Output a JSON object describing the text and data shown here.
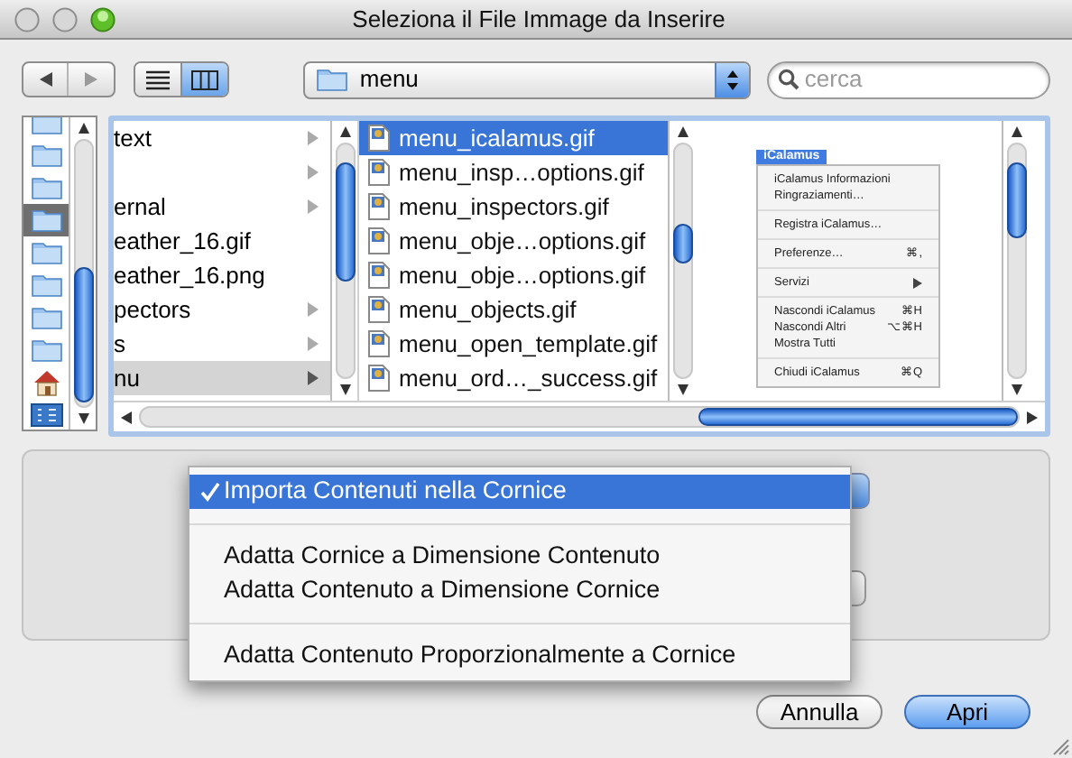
{
  "window": {
    "title": "Seleziona il File Immage da Inserire"
  },
  "toolbar": {
    "view_modes": [
      {
        "kind": "list",
        "selected": false
      },
      {
        "kind": "columns",
        "selected": true
      }
    ],
    "location": {
      "label": "menu"
    },
    "search": {
      "placeholder": "cerca"
    }
  },
  "sidebar": {
    "items": [
      {
        "kind": "folder",
        "selected": false
      },
      {
        "kind": "folder",
        "selected": false
      },
      {
        "kind": "folder",
        "selected": false
      },
      {
        "kind": "folder",
        "selected": true
      },
      {
        "kind": "folder",
        "selected": false
      },
      {
        "kind": "folder",
        "selected": false
      },
      {
        "kind": "folder",
        "selected": false
      },
      {
        "kind": "folder",
        "selected": false
      },
      {
        "kind": "home",
        "selected": false
      },
      {
        "kind": "applications",
        "selected": false
      }
    ]
  },
  "browser": {
    "parent_column": [
      {
        "label": "text",
        "folder": true,
        "selected": false
      },
      {
        "folder": true,
        "selected": false
      },
      {
        "label": "ernal",
        "folder": true,
        "selected": false
      },
      {
        "label": "eather_16.gif",
        "folder": false,
        "selected": false
      },
      {
        "label": "eather_16.png",
        "folder": false,
        "selected": false
      },
      {
        "label": "pectors",
        "folder": true,
        "selected": false
      },
      {
        "label": "s",
        "folder": true,
        "selected": false
      },
      {
        "label": "nu",
        "folder": true,
        "selected": true
      }
    ],
    "file_column": [
      {
        "label": "menu_icalamus.gif",
        "selected": true
      },
      {
        "label": "menu_insp…options.gif",
        "selected": false
      },
      {
        "label": "menu_inspectors.gif",
        "selected": false
      },
      {
        "label": "menu_obje…options.gif",
        "selected": false
      },
      {
        "label": "menu_obje…options.gif",
        "selected": false
      },
      {
        "label": "menu_objects.gif",
        "selected": false
      },
      {
        "label": "menu_open_template.gif",
        "selected": false
      },
      {
        "label": "menu_ord…_success.gif",
        "selected": false
      }
    ],
    "preview": {
      "menu_title": "iCalamus",
      "groups": [
        [
          {
            "label": "iCalamus Informazioni"
          },
          {
            "label": "Ringraziamenti…"
          }
        ],
        [
          {
            "label": "Registra iCalamus…"
          }
        ],
        [
          {
            "label": "Preferenze…",
            "shortcut": "⌘,"
          }
        ],
        [
          {
            "label": "Servizi",
            "submenu": true
          }
        ],
        [
          {
            "label": "Nascondi iCalamus",
            "shortcut": "⌘H"
          },
          {
            "label": "Nascondi Altri",
            "shortcut": "⌥⌘H"
          },
          {
            "label": "Mostra Tutti"
          }
        ],
        [
          {
            "label": "Chiudi iCalamus",
            "shortcut": "⌘Q"
          }
        ]
      ]
    }
  },
  "options_menu": {
    "items": [
      {
        "kind": "item",
        "label": "Importa Contenuti nella Cornice",
        "checked": true,
        "selected": true
      },
      {
        "kind": "separator"
      },
      {
        "kind": "item",
        "label": "Adatta Cornice a Dimensione Contenuto",
        "checked": false,
        "selected": false
      },
      {
        "kind": "item",
        "label": "Adatta Contenuto a Dimensione Cornice",
        "checked": false,
        "selected": false
      },
      {
        "kind": "separator"
      },
      {
        "kind": "item",
        "label": "Adatta Contenuto Proporzionalmente a Cornice",
        "checked": false,
        "selected": false
      }
    ]
  },
  "buttons": [
    {
      "label": "Annulla",
      "default": false
    },
    {
      "label": "Apri",
      "default": true
    }
  ]
}
